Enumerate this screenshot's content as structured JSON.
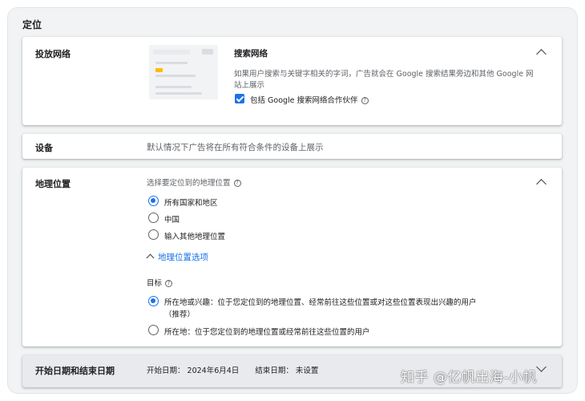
{
  "section": {
    "title": "定位"
  },
  "network": {
    "label": "投放网络",
    "option_title": "搜索网络",
    "description_line1": "如果用户搜索与关键字相关的字词，广告就会在 Google 搜索结果旁边和其他 Google 网",
    "description_line2": "站上展示",
    "checkbox_label": "包括 Google 搜索网络合作伙伴",
    "checkbox_checked": true
  },
  "devices": {
    "label": "设备",
    "summary": "默认情况下广告将在所有符合条件的设备上展示"
  },
  "location": {
    "label": "地理位置",
    "prompt": "选择要定位到的地理位置",
    "options": [
      "所有国家和地区",
      "中国",
      "输入其他地理位置"
    ],
    "selected_index": 0,
    "options_link": "地理位置选项",
    "target_label": "目标",
    "target_options": [
      {
        "line1": "所在地或兴趣：位于您定位到的地理位置、经常前往这些位置或对这些位置表现出兴趣的用户",
        "line2": "（推荐）"
      },
      {
        "line1": "所在地：位于您定位到的地理位置或经常前往这些位置的用户",
        "line2": ""
      }
    ],
    "target_selected_index": 0
  },
  "dates": {
    "label": "开始日期和结束日期",
    "start_label": "开始日期：",
    "start_value": "2024年6月4日",
    "end_label": "结束日期：",
    "end_value": "未设置"
  },
  "watermark": "知乎 @亿帆出海-小帆",
  "colors": {
    "accent": "#1a73e8",
    "background": "#f1f3f4"
  }
}
